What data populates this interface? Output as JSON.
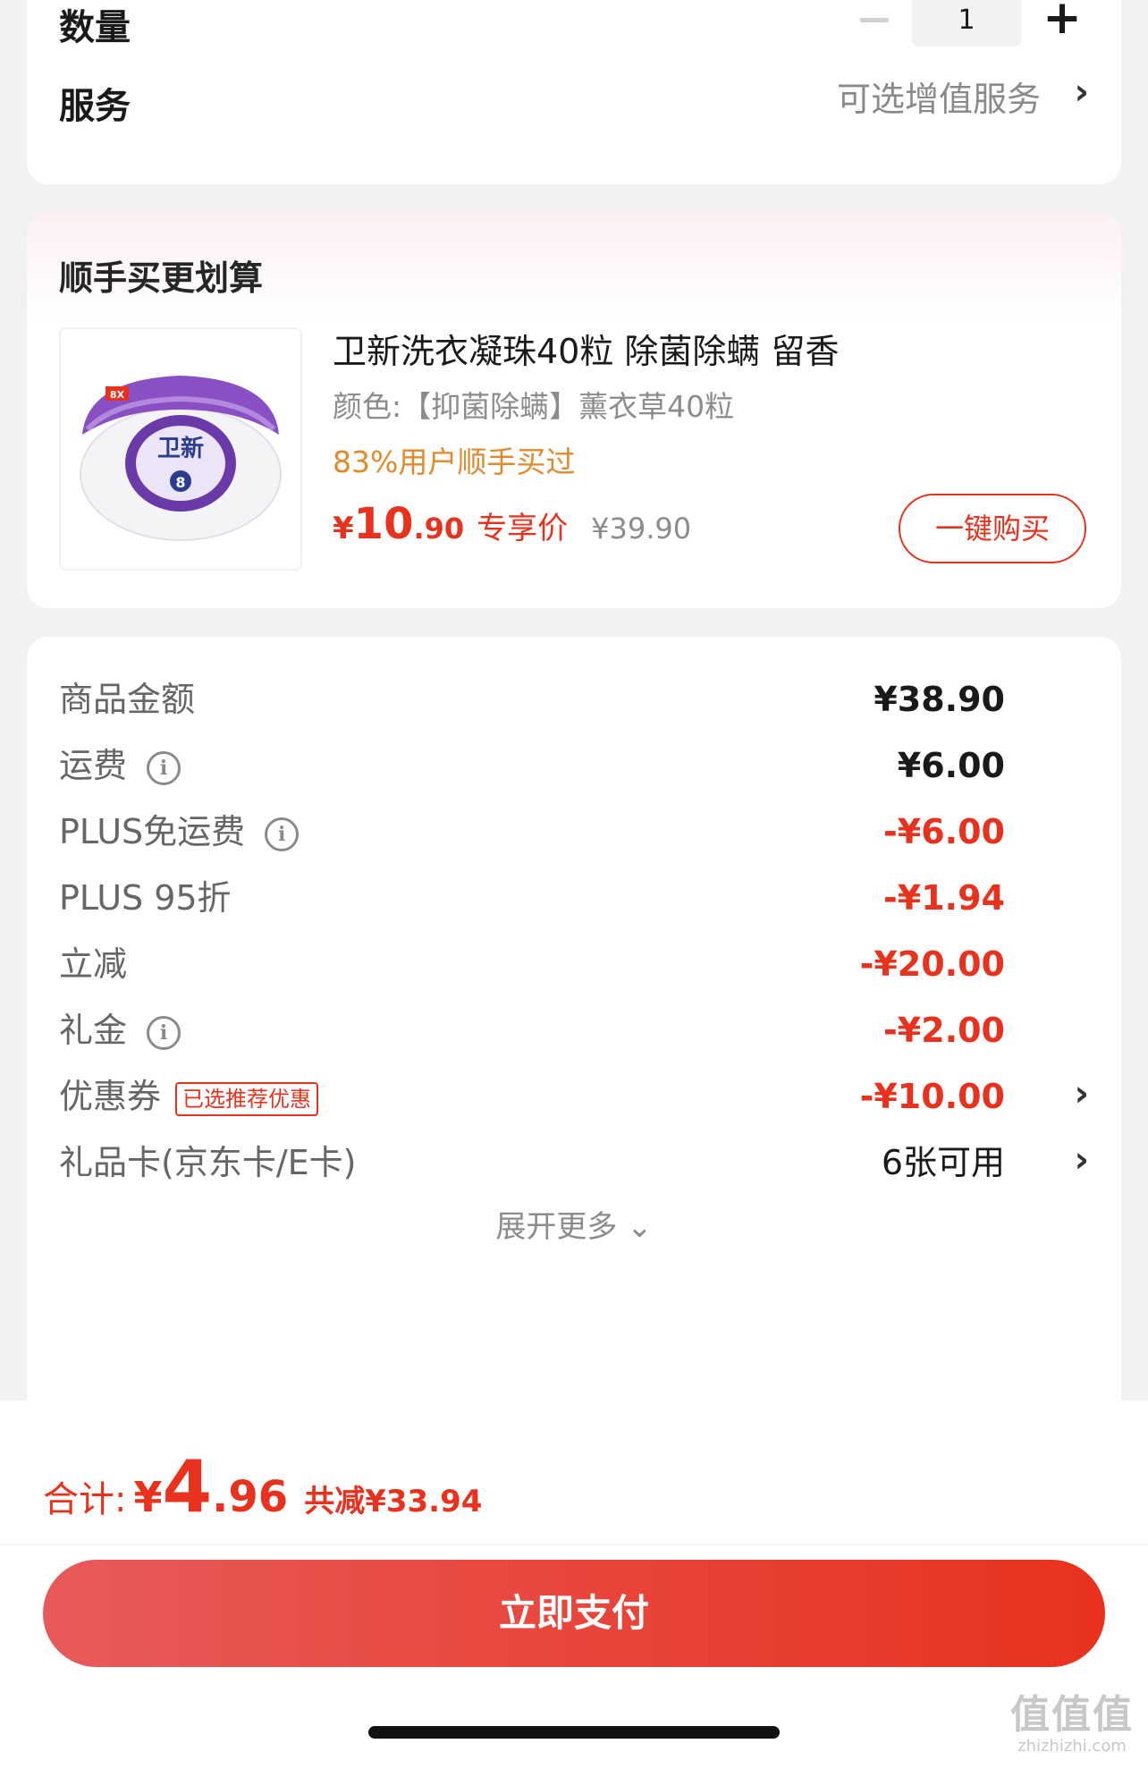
{
  "quantity_row": {
    "label": "数量",
    "value": "1",
    "minus": "−",
    "plus": "+"
  },
  "service_row": {
    "label": "服务",
    "value": "可选增值服务",
    "chevron": "›"
  },
  "bundle": {
    "title": "顺手买更划算",
    "product": {
      "name": "卫新洗衣凝珠40粒 除菌除螨 留香",
      "variant": "颜色:【抑菌除螨】薰衣草40粒",
      "stat": "83%用户顺手买过",
      "price_symbol": "¥",
      "price_int": "10",
      "price_dec": ".90",
      "price_tag": "专享价",
      "original_price": "¥39.90",
      "image_icon": "laundry-pods-tub-icon",
      "image_brand": "卫新",
      "image_badge": "8X",
      "image_count": "8"
    },
    "one_click_label": "一键购买"
  },
  "fees": [
    {
      "label": "商品金额",
      "value": "¥38.90",
      "color": "dark",
      "info": false
    },
    {
      "label": "运费",
      "value": "¥6.00",
      "color": "dark",
      "info": true
    },
    {
      "label": "PLUS免运费",
      "value": "-¥6.00",
      "color": "red",
      "info": true
    },
    {
      "label": "PLUS 95折",
      "value": "-¥1.94",
      "color": "red",
      "info": false
    },
    {
      "label": "立减",
      "value": "-¥20.00",
      "color": "red",
      "info": false
    },
    {
      "label": "礼金",
      "value": "-¥2.00",
      "color": "red",
      "info": true
    },
    {
      "label": "优惠券",
      "value": "-¥10.00",
      "color": "red",
      "info": false,
      "badge": "已选推荐优惠",
      "chevron": "›"
    },
    {
      "label": "礼品卡(京东卡/E卡)",
      "value": "6张可用",
      "color": "plain",
      "info": false,
      "chevron": "›"
    }
  ],
  "info_icon_glyph": "i",
  "expand_label": "展开更多 ⌄",
  "total": {
    "label": "合计:",
    "symbol": "¥",
    "int": "4",
    "dec": ".96",
    "saving": "共减¥33.94"
  },
  "pay_button_label": "立即支付",
  "watermark": {
    "logo": "值值值",
    "url": "zhizhizhi.com"
  },
  "colors": {
    "accent": "#e8321e",
    "stat_orange": "#e08a2c",
    "muted": "#8c8c8c",
    "background": "#f2f2f2"
  }
}
